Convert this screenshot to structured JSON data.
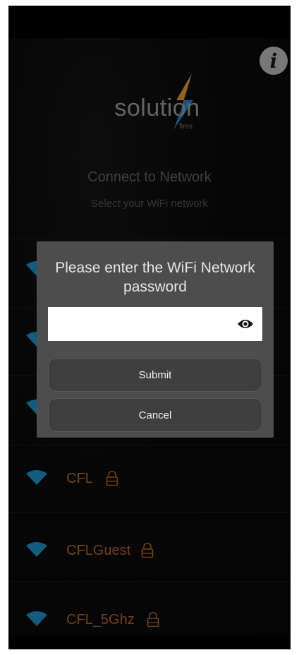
{
  "app": {
    "logo_text": "solution",
    "logo_sub": "fires",
    "info_icon_glyph": "i"
  },
  "header": {
    "title": "Connect to Network",
    "subtitle": "Select your WiFi network"
  },
  "networks": [
    {
      "name": "",
      "locked": true
    },
    {
      "name": "",
      "locked": true
    },
    {
      "name": "",
      "locked": true
    },
    {
      "name": "CFL",
      "locked": true
    },
    {
      "name": "CFLGuest",
      "locked": true
    },
    {
      "name": "CFL_5Ghz",
      "locked": true
    }
  ],
  "dialog": {
    "title": "Please enter the WiFi Network password",
    "password_value": "",
    "submit_label": "Submit",
    "cancel_label": "Cancel"
  },
  "icons": {
    "wifi": "wifi-icon",
    "lock": "lock-icon",
    "eye": "eye-icon",
    "info": "info-icon"
  },
  "colors": {
    "network_name": "#b3631c",
    "wifi_icon": "#1d8fc4",
    "dialog_bg": "#4d4d4d",
    "logo_bolt_orange": "#e8942a",
    "logo_bolt_blue": "#1e88c8"
  }
}
